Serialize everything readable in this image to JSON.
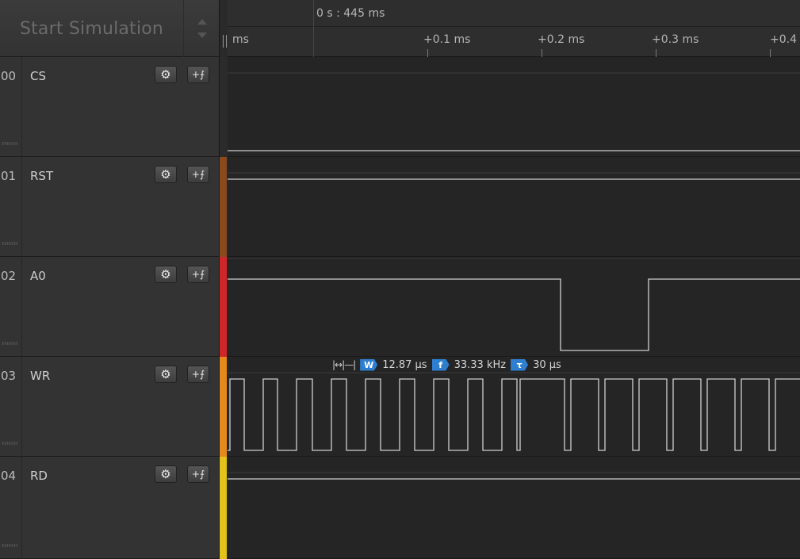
{
  "toolbar": {
    "start_simulation_label": "Start Simulation"
  },
  "timeline": {
    "absolute_time": "0 s : 445 ms",
    "ticks": [
      {
        "label": "ms"
      },
      {
        "label": "+0.1 ms"
      },
      {
        "label": "+0.2 ms"
      },
      {
        "label": "+0.3 ms"
      },
      {
        "label": "+0.4"
      }
    ]
  },
  "channels": [
    {
      "number": "00",
      "name": "CS",
      "color": "#2b2b2b"
    },
    {
      "number": "01",
      "name": "RST",
      "color": "#8a4a1c"
    },
    {
      "number": "02",
      "name": "A0",
      "color": "#d0262a"
    },
    {
      "number": "03",
      "name": "WR",
      "color": "#e6891c"
    },
    {
      "number": "04",
      "name": "RD",
      "color": "#e4c21a"
    }
  ],
  "measurement": {
    "width_badge": "W",
    "width_value": "12.87 µs",
    "freq_badge": "f",
    "freq_value": "33.33 kHz",
    "period_badge": "τ",
    "period_value": "30 µs"
  },
  "icons": {
    "gear": "gear-icon",
    "trigger": "trigger-edge-icon",
    "width_measure": "width-measure-icon"
  }
}
